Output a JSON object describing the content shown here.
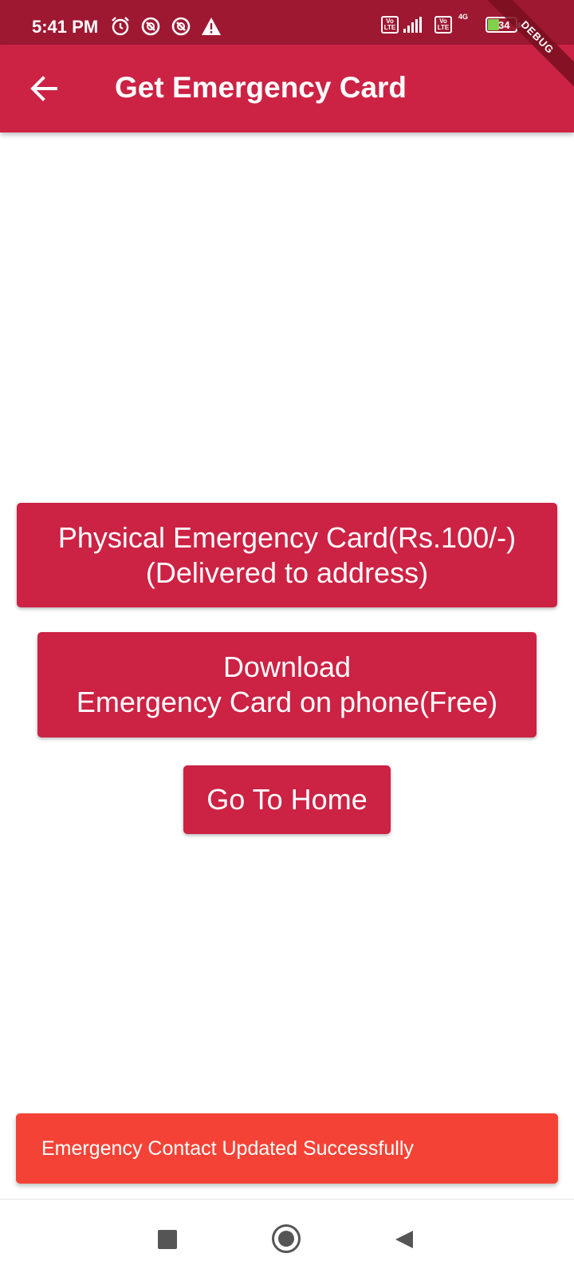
{
  "status_bar": {
    "time": "5:41 PM",
    "icons": [
      "alarm-icon",
      "data-saver-icon",
      "data-saver-icon",
      "warning-icon",
      "volte-icon",
      "signal-icon",
      "volte-icon",
      "4g-signal-icon",
      "battery-icon"
    ],
    "volte_label_top": "Vo",
    "volte_label_bottom": "LTE",
    "network_label": "4G",
    "battery_level": "34",
    "bar_color": "#9e1832"
  },
  "debug_banner": "DEBUG",
  "app_bar": {
    "title": "Get Emergency Card",
    "back_icon": "arrow-back-icon",
    "color": "#cc2244"
  },
  "buttons": {
    "physical_card": {
      "line1": "Physical Emergency Card(Rs.100/-)",
      "line2": "(Delivered to address)"
    },
    "download_card": {
      "line1": "Download",
      "line2": "Emergency Card on phone(Free)"
    },
    "go_home": {
      "label": "Go To Home"
    },
    "color": "#cc2244"
  },
  "snackbar": {
    "message": "Emergency Contact Updated Successfully",
    "color": "#f44336"
  },
  "nav_bar": {
    "icons": [
      "recents-icon",
      "home-icon",
      "back-icon"
    ]
  }
}
